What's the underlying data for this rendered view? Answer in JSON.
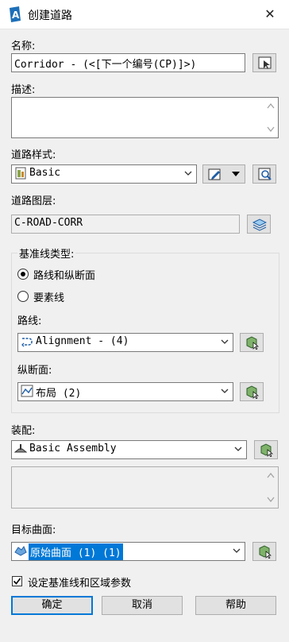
{
  "window": {
    "title": "创建道路"
  },
  "name": {
    "label": "名称:",
    "value": "Corridor - (<[下一个编号(CP)]>)"
  },
  "description": {
    "label": "描述:",
    "value": ""
  },
  "corridor_style": {
    "label": "道路样式:",
    "value": "Basic"
  },
  "corridor_layer": {
    "label": "道路图层:",
    "value": "C-ROAD-CORR"
  },
  "baseline_type": {
    "label": "基准线类型:",
    "options": [
      "路线和纵断面",
      "要素线"
    ],
    "selected": "路线和纵断面"
  },
  "alignment": {
    "label": "路线:",
    "value": "Alignment - (4)"
  },
  "profile": {
    "label": "纵断面:",
    "value": "布局 (2)"
  },
  "assembly": {
    "label": "装配:",
    "value": "Basic Assembly"
  },
  "target_surface": {
    "label": "目标曲面:",
    "value": "原始曲面 (1) (1)"
  },
  "set_params": {
    "label": "设定基准线和区域参数",
    "checked": true
  },
  "buttons": {
    "ok": "确定",
    "cancel": "取消",
    "help": "帮助"
  },
  "colors": {
    "selection": "#0078d7",
    "accent_border": "#0078d7",
    "background": "#f0f0f0"
  },
  "icons": [
    "autocad-icon",
    "close-icon",
    "pick-from-drawing-icon",
    "style-icon",
    "edit-style-icon",
    "preview-icon",
    "layer-icon",
    "alignment-icon",
    "profile-icon",
    "assembly-icon",
    "surface-icon",
    "select-from-drawing-icon"
  ]
}
